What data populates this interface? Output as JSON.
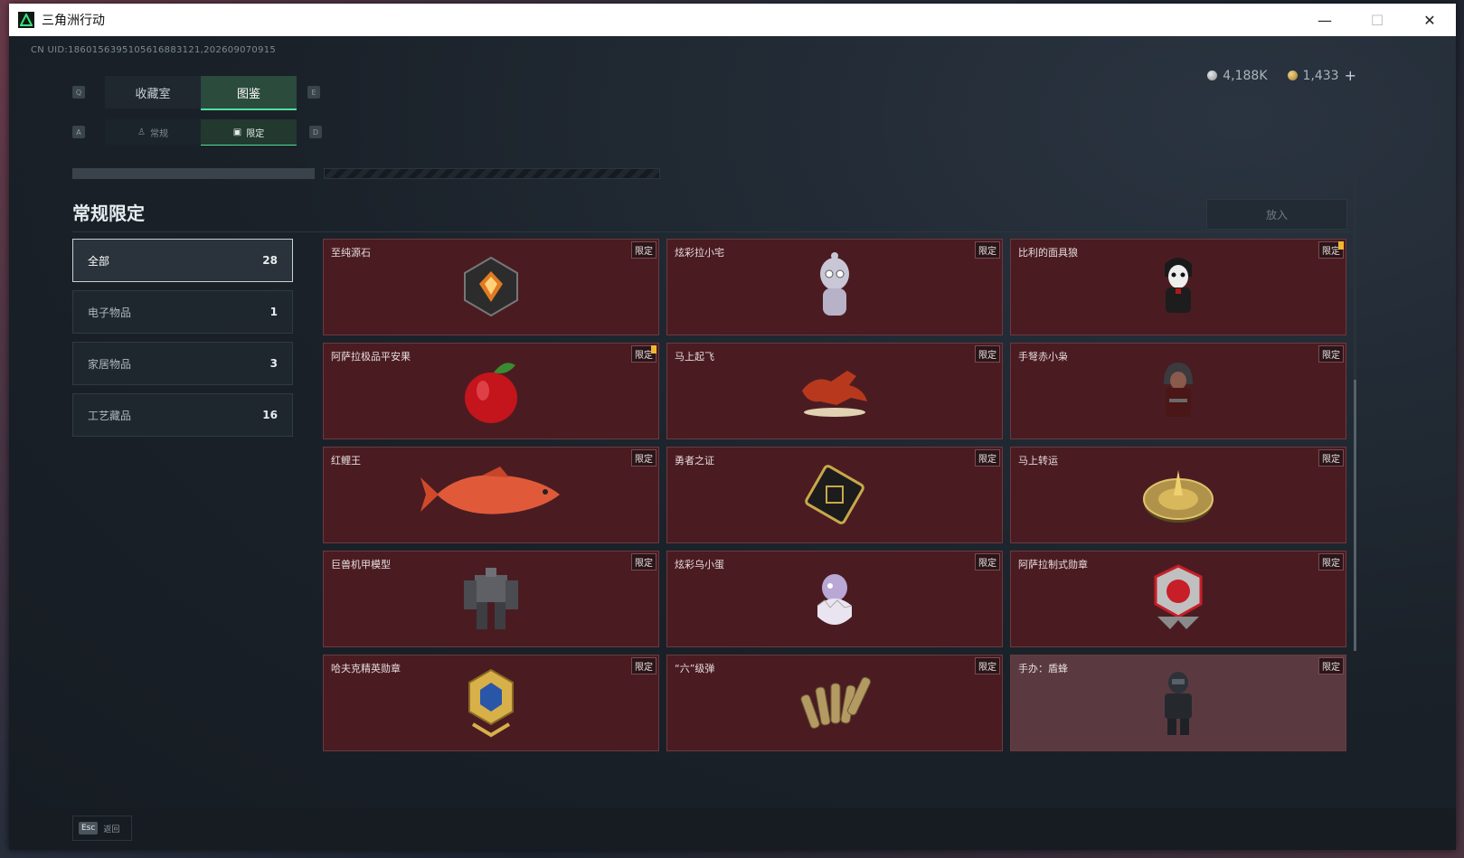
{
  "window": {
    "title": "三角洲行动",
    "minimize": "—",
    "maximize": "☐",
    "close": "✕"
  },
  "uid": "CN UID:1860156395105616883121,202609070915",
  "currency": {
    "silver": "4,188K",
    "gold": "1,433",
    "add": "+"
  },
  "keys": {
    "tab_prev": "Q",
    "tab_next": "E",
    "sub_prev": "A",
    "sub_next": "D",
    "esc": "Esc"
  },
  "tabs": [
    {
      "label": "收藏室",
      "active": false
    },
    {
      "label": "图鉴",
      "active": true
    }
  ],
  "subtabs": [
    {
      "icon": "♙",
      "label": "常规",
      "active": false
    },
    {
      "icon": "▣",
      "label": "限定",
      "active": true
    }
  ],
  "section_title": "常规限定",
  "action_label": "放入",
  "categories": [
    {
      "label": "全部",
      "count": "28",
      "active": true
    },
    {
      "label": "电子物品",
      "count": "1",
      "active": false
    },
    {
      "label": "家居物品",
      "count": "3",
      "active": false
    },
    {
      "label": "工艺藏品",
      "count": "16",
      "active": false
    }
  ],
  "badge_label": "限定",
  "items": [
    {
      "name": "至纯源石",
      "icon": "crystal-icon",
      "notify": false
    },
    {
      "name": "炫彩拉小宅",
      "icon": "figurine-icon",
      "notify": false
    },
    {
      "name": "比利的面具狼",
      "icon": "mask-figure-icon",
      "notify": true
    },
    {
      "name": "阿萨拉极品平安果",
      "icon": "apple-icon",
      "notify": true
    },
    {
      "name": "马上起飞",
      "icon": "horse-icon",
      "notify": false
    },
    {
      "name": "手弩赤小枭",
      "icon": "hooded-figure-icon",
      "notify": false
    },
    {
      "name": "红鲤王",
      "icon": "carp-icon",
      "notify": false
    },
    {
      "name": "勇者之证",
      "icon": "card-icon",
      "notify": false
    },
    {
      "name": "马上转运",
      "icon": "compass-icon",
      "notify": false
    },
    {
      "name": "巨兽机甲模型",
      "icon": "mech-icon",
      "notify": false
    },
    {
      "name": "炫彩乌小蛋",
      "icon": "egg-icon",
      "notify": false
    },
    {
      "name": "阿萨拉制式勋章",
      "icon": "medal-icon",
      "notify": false
    },
    {
      "name": "哈夫克精英勋章",
      "icon": "badge-icon",
      "notify": false
    },
    {
      "name": "“六”级弹",
      "icon": "bullets-icon",
      "notify": false
    },
    {
      "name": "手办：盾蜂",
      "icon": "soldier-figure-icon",
      "notify": false
    }
  ],
  "colors": {
    "accent": "#4fe09a",
    "card_bg": "#4a1c22",
    "notify": "#f2b632"
  },
  "footer": {
    "back": "返回"
  }
}
